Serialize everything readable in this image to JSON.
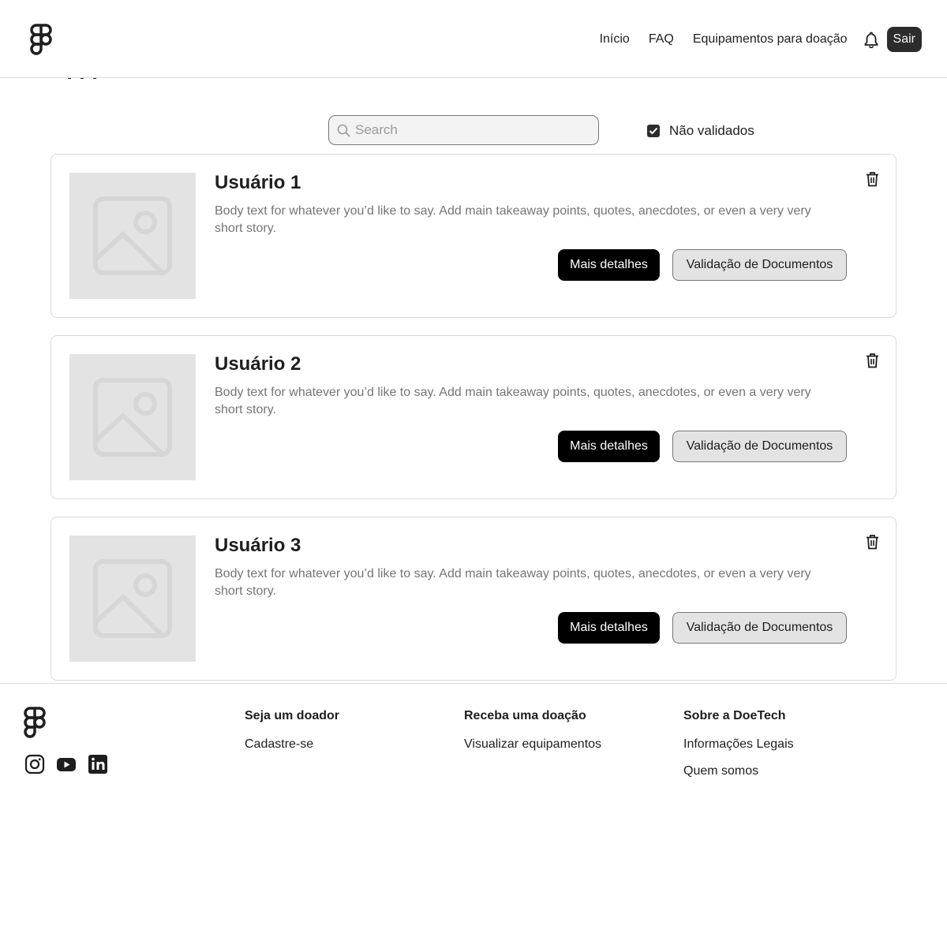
{
  "header": {
    "nav": [
      "Início",
      "FAQ",
      "Equipamentos para doação"
    ],
    "logout_label": "Sair"
  },
  "search": {
    "placeholder": "Search"
  },
  "filter": {
    "label": "Não validados",
    "checked": true
  },
  "cards": [
    {
      "title": "Usuário 1",
      "body": "Body text for whatever you’d like to say. Add main takeaway points, quotes, anecdotes, or even a very very short story.",
      "primary_label": "Mais detalhes",
      "secondary_label": "Validação de Documentos"
    },
    {
      "title": "Usuário 2",
      "body": "Body text for whatever you’d like to say. Add main takeaway points, quotes, anecdotes, or even a very very short story.",
      "primary_label": "Mais detalhes",
      "secondary_label": "Validação de Documentos"
    },
    {
      "title": "Usuário 3",
      "body": "Body text for whatever you’d like to say. Add main takeaway points, quotes, anecdotes, or even a very very short story.",
      "primary_label": "Mais detalhes",
      "secondary_label": "Validação de Documentos"
    }
  ],
  "footer": {
    "columns": [
      {
        "title": "Seja um doador",
        "links": [
          "Cadastre-se"
        ]
      },
      {
        "title": "Receba uma doação",
        "links": [
          "Visualizar equipamentos"
        ]
      },
      {
        "title": "Sobre a DoeTech",
        "links": [
          "Informações Legais",
          "Quem somos"
        ]
      }
    ],
    "socials": [
      "instagram-icon",
      "youtube-icon",
      "linkedin-icon"
    ]
  },
  "colors": {
    "primary": "#000000",
    "dark": "#2c2c2c",
    "border": "#d9d9d9",
    "placeholder_bg": "#e3e3e3",
    "body_text": "#757575"
  }
}
